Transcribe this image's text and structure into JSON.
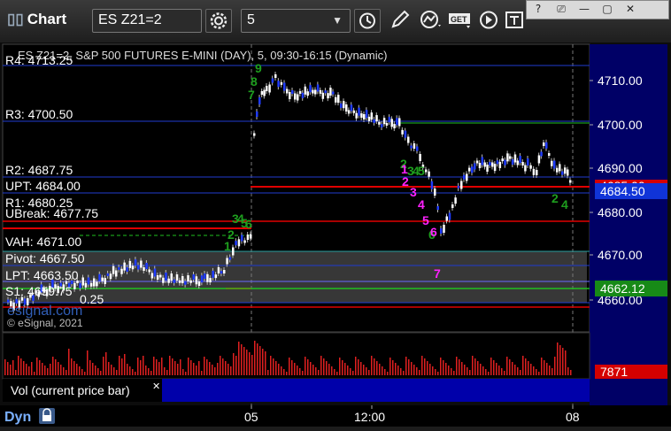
{
  "app": {
    "title": "Chart"
  },
  "toolbar": {
    "symbol": "ES Z21=2",
    "interval": "5",
    "get_label": "GET",
    "window_buttons": [
      "?",
      "⎚",
      "—",
      "▢",
      "✕"
    ]
  },
  "chart": {
    "header": "ES Z21=2, S&P 500 FUTURES E-MINI (DAY), 5, 09:30-16:15 (Dynamic)",
    "copyright": "© eSignal, 2021",
    "watermark": "esignal.com",
    "levels": [
      {
        "label": "R4: 4713.25"
      },
      {
        "label": "R3: 4700.50"
      },
      {
        "label": "R2: 4687.75"
      },
      {
        "label": "UPT: 4684.00"
      },
      {
        "label": "R1: 4680.25"
      },
      {
        "label": "UBreak: 4677.75"
      },
      {
        "label": "VAH: 4671.00"
      },
      {
        "label": "Pivot: 4667.50"
      },
      {
        "label": "LPT: 4663.50"
      },
      {
        "label": "S1: 4659.75"
      },
      {
        "label": "0.25"
      }
    ],
    "y_ticks": [
      "4710.00",
      "4700.00",
      "4690.00",
      "4680.00",
      "4670.00",
      "4660.00"
    ],
    "price_tags": [
      {
        "text": "4685.00",
        "color": "#d40000"
      },
      {
        "text": "4684.50",
        "color": "#1034d8"
      },
      {
        "text": "4662.12",
        "color": "#178a17"
      }
    ],
    "time_labels": [
      "05",
      "12:00",
      "08"
    ],
    "seq_green": [
      "9",
      "8",
      "7",
      "1",
      "2",
      "3",
      "4",
      "5",
      "6",
      "2",
      "3",
      "4",
      "5",
      "6"
    ],
    "seq_magenta": [
      "1",
      "2",
      "3",
      "4",
      "5",
      "6",
      "7"
    ],
    "seq_green_right": [
      "2",
      "4"
    ]
  },
  "volume": {
    "label": "Vol (current price bar)",
    "value_tag": "7871",
    "close_glyph": "✕"
  },
  "status": {
    "dyn_label": "Dyn"
  },
  "colors": {
    "bull_bar": "#ffffff",
    "bear_bar": "#1f3bff",
    "level_blue": "#1f3bd0",
    "level_red": "#e00000",
    "level_green": "#20c020",
    "value_area": "#4a4a4a",
    "right_axis": "#000066"
  },
  "icons": [
    "settings-gear-icon",
    "clock-icon",
    "pencil-icon",
    "line-indicator-icon",
    "get-data-icon",
    "play-icon",
    "text-tool-icon",
    "lock-icon"
  ]
}
